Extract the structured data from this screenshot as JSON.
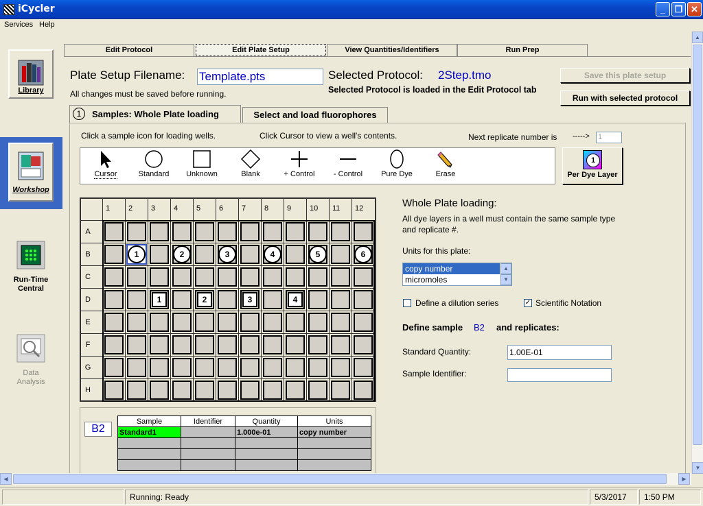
{
  "window": {
    "title": "iCycler",
    "min": "_",
    "max": "❐",
    "close": "✕"
  },
  "menu": {
    "services": "Services",
    "help": "Help"
  },
  "nav": {
    "library": "Library",
    "workshop": "Workshop",
    "runtime": "Run-Time Central",
    "data_analysis": "Data Analysis"
  },
  "tabs": [
    "Edit Protocol",
    "Edit Plate Setup",
    "View Quantities/Identifiers",
    "Run Prep"
  ],
  "plate": {
    "filename_label": "Plate Setup Filename:",
    "filename_value": "Template.pts",
    "protocol_label": "Selected Protocol:",
    "protocol_value": "2Step.tmo",
    "save_note": "All changes must be saved before running.",
    "protocol_note": "Selected Protocol is loaded in the Edit Protocol tab",
    "save_button": "Save this plate setup",
    "run_button": "Run with selected protocol"
  },
  "subtabs": {
    "step": "1",
    "samples": "Samples: Whole Plate loading",
    "fluorophores": "Select and load fluorophores"
  },
  "instructions": {
    "click_icon": "Click a sample icon for loading wells.",
    "click_cursor": "Click Cursor to view a well's contents.",
    "next_replicate": "Next replicate number is",
    "arrow": "----->",
    "next_value": "1"
  },
  "tools": [
    "Cursor",
    "Standard",
    "Unknown",
    "Blank",
    "+ Control",
    "- Control",
    "Pure Dye",
    "Erase"
  ],
  "per_dye": {
    "label": "Per Dye Layer",
    "number": "1"
  },
  "grid": {
    "columns": [
      "1",
      "2",
      "3",
      "4",
      "5",
      "6",
      "7",
      "8",
      "9",
      "10",
      "11",
      "12"
    ],
    "rows": [
      "A",
      "B",
      "C",
      "D",
      "E",
      "F",
      "G",
      "H"
    ],
    "standards": [
      {
        "row": "B",
        "col": "2",
        "n": "1"
      },
      {
        "row": "B",
        "col": "4",
        "n": "2"
      },
      {
        "row": "B",
        "col": "6",
        "n": "3"
      },
      {
        "row": "B",
        "col": "8",
        "n": "4"
      },
      {
        "row": "B",
        "col": "10",
        "n": "5"
      },
      {
        "row": "B",
        "col": "12",
        "n": "6"
      }
    ],
    "unknowns": [
      {
        "row": "D",
        "col": "3",
        "n": "1"
      },
      {
        "row": "D",
        "col": "5",
        "n": "2"
      },
      {
        "row": "D",
        "col": "7",
        "n": "3"
      },
      {
        "row": "D",
        "col": "9",
        "n": "4"
      }
    ],
    "selected": {
      "row": "B",
      "col": "2"
    }
  },
  "right": {
    "title": "Whole Plate loading:",
    "desc": "All dye layers in a well must contain the same sample type and replicate #.",
    "units_label": "Units for this plate:",
    "units_options": [
      "copy number",
      "micromoles"
    ],
    "dilution": "Define a dilution series",
    "scientific": "Scientific Notation",
    "define_label": "Define sample",
    "define_well": "B2",
    "define_suffix": "and replicates:",
    "std_qty_label": "Standard Quantity:",
    "std_qty_value": "1.00E-01",
    "sample_id_label": "Sample Identifier:",
    "sample_id_value": ""
  },
  "well_info": {
    "well": "B2",
    "headers": [
      "Sample",
      "Identifier",
      "Quantity",
      "Units"
    ],
    "row": [
      "Standard1",
      "",
      "1.000e-01",
      "copy number"
    ]
  },
  "status": {
    "state": "Running: Ready",
    "date": "5/3/2017",
    "time": "1:50 PM"
  },
  "colors": {
    "title_blue": "#0846c7",
    "selection": "#316ac5",
    "green": "#00ff00",
    "blue_text": "#0000c0"
  }
}
